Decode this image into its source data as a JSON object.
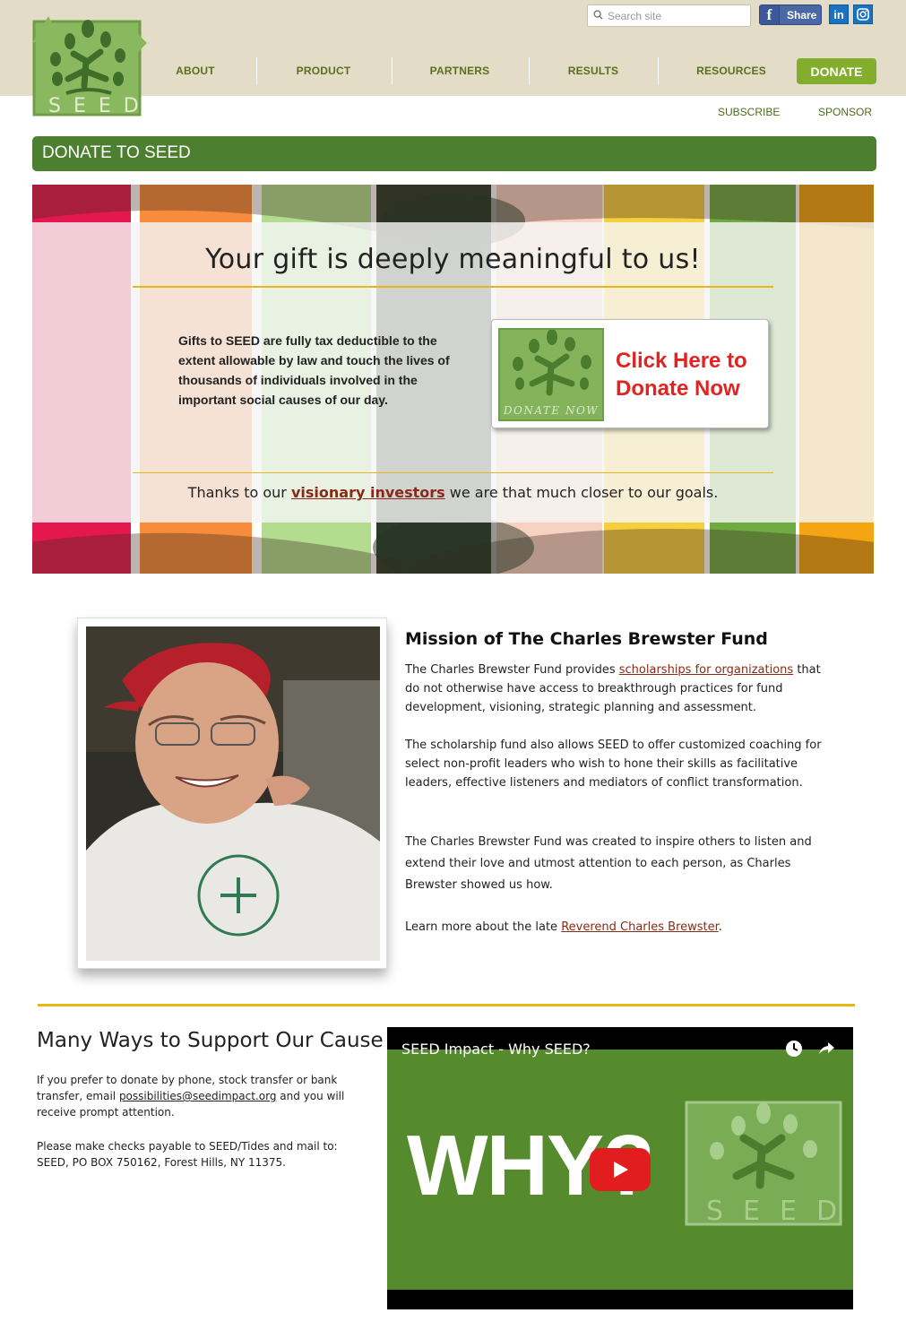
{
  "header": {
    "logo_text": "SEED",
    "search_placeholder": "Search site",
    "share_label": "Share",
    "linkedin_label": "in",
    "nav": [
      "ABOUT",
      "PRODUCT",
      "PARTNERS",
      "RESULTS",
      "RESOURCES"
    ],
    "donate_label": "DONATE",
    "subnav": [
      "SUBSCRIBE",
      "SPONSOR"
    ]
  },
  "page_title": "DONATE TO SEED",
  "hero": {
    "heading": "Your gift is deeply meaningful to us!",
    "gifts_text": "Gifts to SEED are fully tax deductible to the extent allowable by law and touch the lives of thousands of individuals involved in the important social causes of our day.",
    "donate_now_badge": "DONATE NOW",
    "cta_line1": "Click Here to",
    "cta_line2": "Donate Now",
    "thanks_before": "Thanks to our ",
    "thanks_link": "visionary investors",
    "thanks_after": " we are that much closer to our goals."
  },
  "mission": {
    "title": "Mission of The Charles Brewster Fund",
    "p1_before": "The Charles Brewster Fund provides ",
    "p1_link": "scholarships for organizations",
    "p1_after": " that do not otherwise have access to breakthrough practices for fund development, visioning, strategic planning and assessment.",
    "p2": "The scholarship fund also allows SEED to offer customized coaching for select non-profit leaders who wish to hone their skills as facilitative leaders, effective listeners and mediators of conflict transformation.",
    "p3": "The Charles Brewster Fund was created to inspire others to listen and extend their love and utmost attention to each person, as Charles Brewster showed us how.",
    "p4_before": "Learn more about the late ",
    "p4_link": "Reverend Charles Brewster",
    "p4_after": "."
  },
  "support": {
    "title": "Many Ways to Support Our Cause",
    "p1_before": "If you prefer to donate by phone, stock transfer or bank transfer, email ",
    "p1_link": "possibilities@seedimpact.org",
    "p1_after": " and you will receive prompt attention.",
    "p2_line1": "Please make checks payable to SEED/Tides and mail to:",
    "p2_line2": "SEED, PO BOX 750162, Forest Hills, NY  11375."
  },
  "video": {
    "title": "SEED Impact - Why SEED?",
    "big_text": "WHY?",
    "logo_text": "SEED"
  },
  "colors": {
    "header_bg": "#e3dcc6",
    "nav_text": "#5b6f1f",
    "donate_button": "#82ad2d",
    "title_bar": "#4c8030",
    "accent_yellow": "#e7b814",
    "link_red": "#8a2a16",
    "cta_red": "#e32222"
  }
}
